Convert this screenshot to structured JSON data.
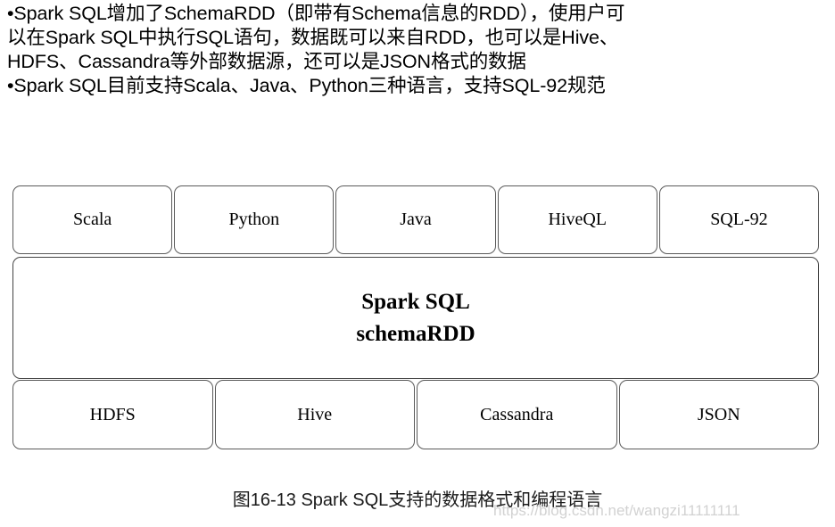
{
  "bullets": [
    "•Spark SQL增加了SchemaRDD（即带有Schema信息的RDD），使用户可",
    "以在Spark SQL中执行SQL语句，数据既可以来自RDD，也可以是Hive、",
    "HDFS、Cassandra等外部数据源，还可以是JSON格式的数据",
    "•Spark SQL目前支持Scala、Java、Python三种语言，支持SQL-92规范"
  ],
  "diagram": {
    "top_row": [
      {
        "label": "Scala"
      },
      {
        "label": "Python"
      },
      {
        "label": "Java"
      },
      {
        "label": "HiveQL"
      },
      {
        "label": "SQL-92"
      }
    ],
    "center": {
      "line1": "Spark SQL",
      "line2": "schemaRDD"
    },
    "bottom_row": [
      {
        "label": "HDFS"
      },
      {
        "label": "Hive"
      },
      {
        "label": "Cassandra"
      },
      {
        "label": "JSON"
      }
    ]
  },
  "caption": "图16-13 Spark SQL支持的数据格式和编程语言",
  "watermark": "https://blog.csdn.net/wangzi11111111",
  "colors": {
    "text": "#000000",
    "box_border": "#5a5a5a",
    "box_fill": "#ffffff",
    "watermark": "#d2d2d2",
    "background": "#ffffff"
  }
}
